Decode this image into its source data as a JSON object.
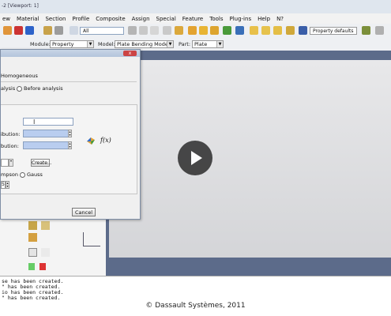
{
  "window": {
    "title": "-2 [Viewport: 1]"
  },
  "menu": [
    "ew",
    "Material",
    "Section",
    "Profile",
    "Composite",
    "Assign",
    "Special",
    "Feature",
    "Tools",
    "Plug-ins",
    "Help",
    "N?"
  ],
  "toolbar": {
    "selection_filter": "All",
    "property_defaults": "Property defaults"
  },
  "context": {
    "module_label": "Module:",
    "module_value": "Property",
    "model_label": "Model:",
    "model_value": "Plate Bending Model",
    "part_label": "Part:",
    "part_value": "Plate"
  },
  "dialog": {
    "close_label": "x",
    "type_value": "Homogeneous",
    "radio_during": "alysis",
    "radio_before": "Before analysis",
    "dist1_label": "ibution:",
    "dist2_label": "bution:",
    "fx_label": "f(x)",
    "create_label": "Create...",
    "radio_simpson": "mpson",
    "radio_gauss": "Gauss",
    "spin_value": "5",
    "cancel_label": "Cancel"
  },
  "messages": [
    "se has been created.",
    "\" has been created.",
    "io has been created.",
    "\" has been created."
  ],
  "footer": {
    "copyright": "© Dassault Systèmes, 2011"
  },
  "colors": {
    "viewport_frame": "#5c6b8a",
    "field_blue": "#b9cdef"
  }
}
